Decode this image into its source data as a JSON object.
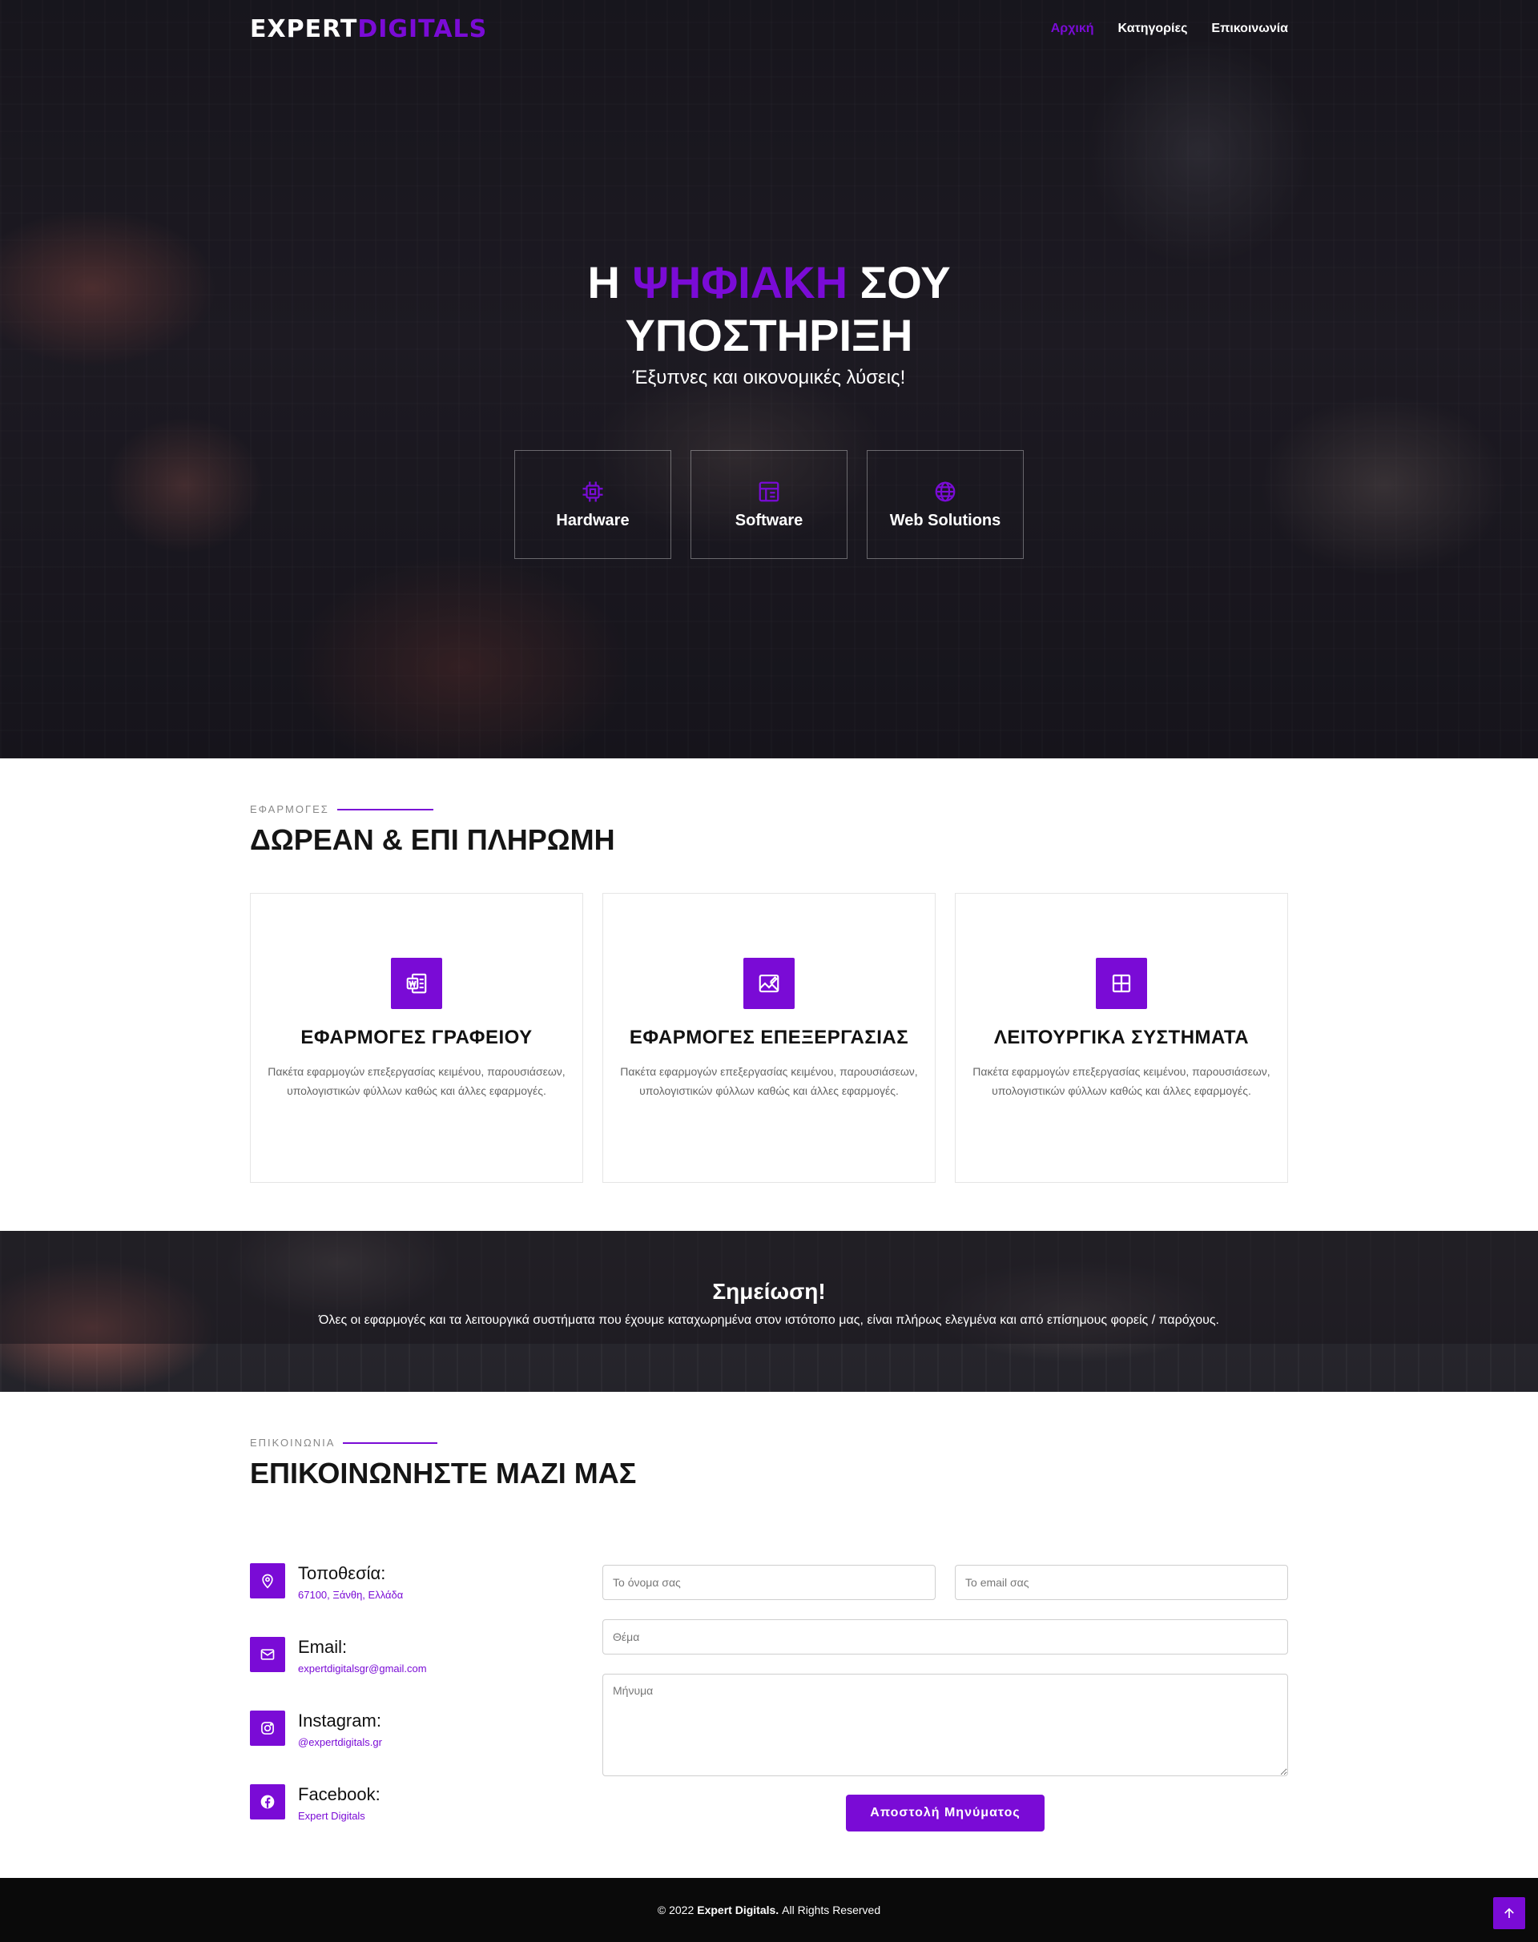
{
  "brand": {
    "part1": "EXPERT",
    "part2": "DIGITALS",
    "accent_color": "#7a0bd6"
  },
  "nav": {
    "items": [
      "Αρχική",
      "Κατηγορίες",
      "Επικοινωνία"
    ],
    "active": "Αρχική"
  },
  "hero": {
    "title_part1": "Η ",
    "title_highlight": "ΨΗΦΙΑΚΗ",
    "title_part2": " ΣΟΥ",
    "title_line2": "ΥΠΟΣΤΗΡΙΞΗ",
    "subtitle": "Έξυπνες και οικονομικές λύσεις!",
    "cards": [
      {
        "label": "Hardware",
        "icon": "cpu-icon"
      },
      {
        "label": "Software",
        "icon": "layout-icon"
      },
      {
        "label": "Web Solutions",
        "icon": "globe-icon"
      }
    ]
  },
  "apps": {
    "eyebrow": "ΕΦΑΡΜΟΓΕΣ",
    "title": "ΔΩΡΕΑΝ & ΕΠΙ ΠΛΗΡΩΜΗ",
    "cards": [
      {
        "title": "ΕΦΑΡΜΟΓΕΣ ΓΡΑΦΕΙΟΥ",
        "icon": "word-doc-icon",
        "desc": "Πακέτα εφαρμογών επεξεργασίας κειμένου, παρουσιάσεων, υπολογιστικών φύλλων καθώς και άλλες εφαρμογές."
      },
      {
        "title": "ΕΦΑΡΜΟΓΕΣ ΕΠΕΞΕΡΓΑΣΙΑΣ",
        "icon": "image-edit-icon",
        "desc": "Πακέτα εφαρμογών επεξεργασίας κειμένου, παρουσιάσεων, υπολογιστικών φύλλων καθώς και άλλες εφαρμογές."
      },
      {
        "title": "ΛΕΙΤΟΥΡΓΙΚΑ ΣΥΣΤΗΜΑΤΑ",
        "icon": "windows-icon",
        "desc": "Πακέτα εφαρμογών επεξεργασίας κειμένου, παρουσιάσεων, υπολογιστικών φύλλων καθώς και άλλες εφαρμογές."
      }
    ]
  },
  "note": {
    "title": "Σημείωση!",
    "text": "Όλες οι εφαρμογές και τα λειτουργικά συστήματα που έχουμε καταχωρημένα στον ιστότοπο μας, είναι πλήρως ελεγμένα και από επίσημους φορείς / παρόχους."
  },
  "contact": {
    "eyebrow": "ΕΠΙΚΟΙΝΩΝΙΑ",
    "title": "ΕΠΙΚΟΙΝΩΝΗΣΤΕ ΜΑΖΙ ΜΑΣ",
    "info": [
      {
        "label": "Τοποθεσία:",
        "value": "67100, Ξάνθη, Ελλάδα",
        "icon": "map-pin-icon"
      },
      {
        "label": "Email:",
        "value": "expertdigitalsgr@gmail.com",
        "icon": "envelope-icon"
      },
      {
        "label": "Instagram:",
        "value": "@expertdigitals.gr",
        "icon": "instagram-icon"
      },
      {
        "label": "Facebook:",
        "value": "Expert Digitals",
        "icon": "facebook-icon"
      }
    ],
    "form": {
      "name_placeholder": "Το όνομα σας",
      "email_placeholder": "Το email σας",
      "subject_placeholder": "Θέμα",
      "message_placeholder": "Μήνυμα",
      "submit_label": "Αποστολή Μηνύματος"
    }
  },
  "footer": {
    "prefix": "© 2022",
    "brand": "Expert Digitals.",
    "suffix": "All Rights Reserved"
  },
  "scroll_top": {
    "icon": "arrow-up-icon"
  }
}
